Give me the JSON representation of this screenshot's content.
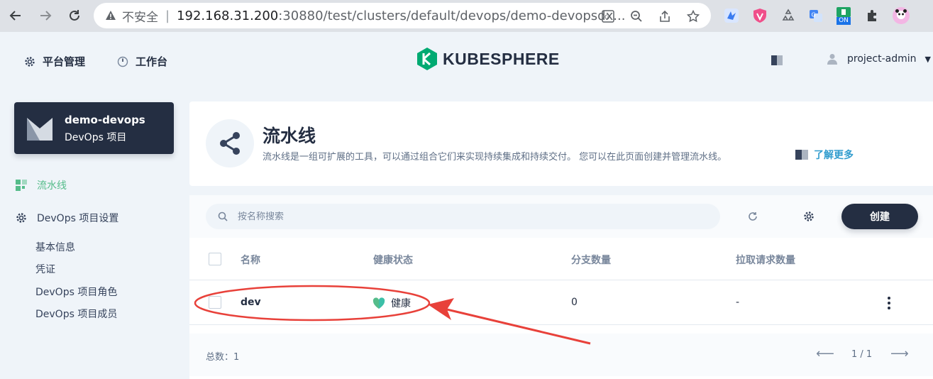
{
  "browser": {
    "insecure_label": "不安全",
    "url_host": "192.168.31.200",
    "url_rest": ":30880/test/clusters/default/devops/demo-devopsdx...",
    "extension_badge": "ON"
  },
  "header": {
    "platform_label": "平台管理",
    "workbench_label": "工作台",
    "logo_text": "KUBESPHERE",
    "user_name": "project-admin"
  },
  "sidebar": {
    "project_name": "demo-devops",
    "project_type": "DevOps 项目",
    "nav_pipelines": "流水线",
    "nav_settings": "DevOps 项目设置",
    "sub_items": [
      "基本信息",
      "凭证",
      "DevOps 项目角色",
      "DevOps 项目成员"
    ]
  },
  "banner": {
    "title": "流水线",
    "description": "流水线是一组可扩展的工具，可以通过组合它们来实现持续集成和持续交付。 您可以在此页面创建并管理流水线。",
    "learn_more": "了解更多"
  },
  "toolbar": {
    "search_placeholder": "按名称搜索",
    "create_label": "创建"
  },
  "table": {
    "columns": [
      "名称",
      "健康状态",
      "分支数量",
      "拉取请求数量"
    ],
    "rows": [
      {
        "name": "dev",
        "health": "健康",
        "branches": "0",
        "pull_requests": "-"
      }
    ]
  },
  "footer": {
    "total_label": "总数：1",
    "page": "1 / 1"
  },
  "colors": {
    "primary_dark": "#242e42",
    "accent_green": "#55bc8a",
    "link_blue": "#329dce",
    "annotation_red": "#e8413a"
  }
}
